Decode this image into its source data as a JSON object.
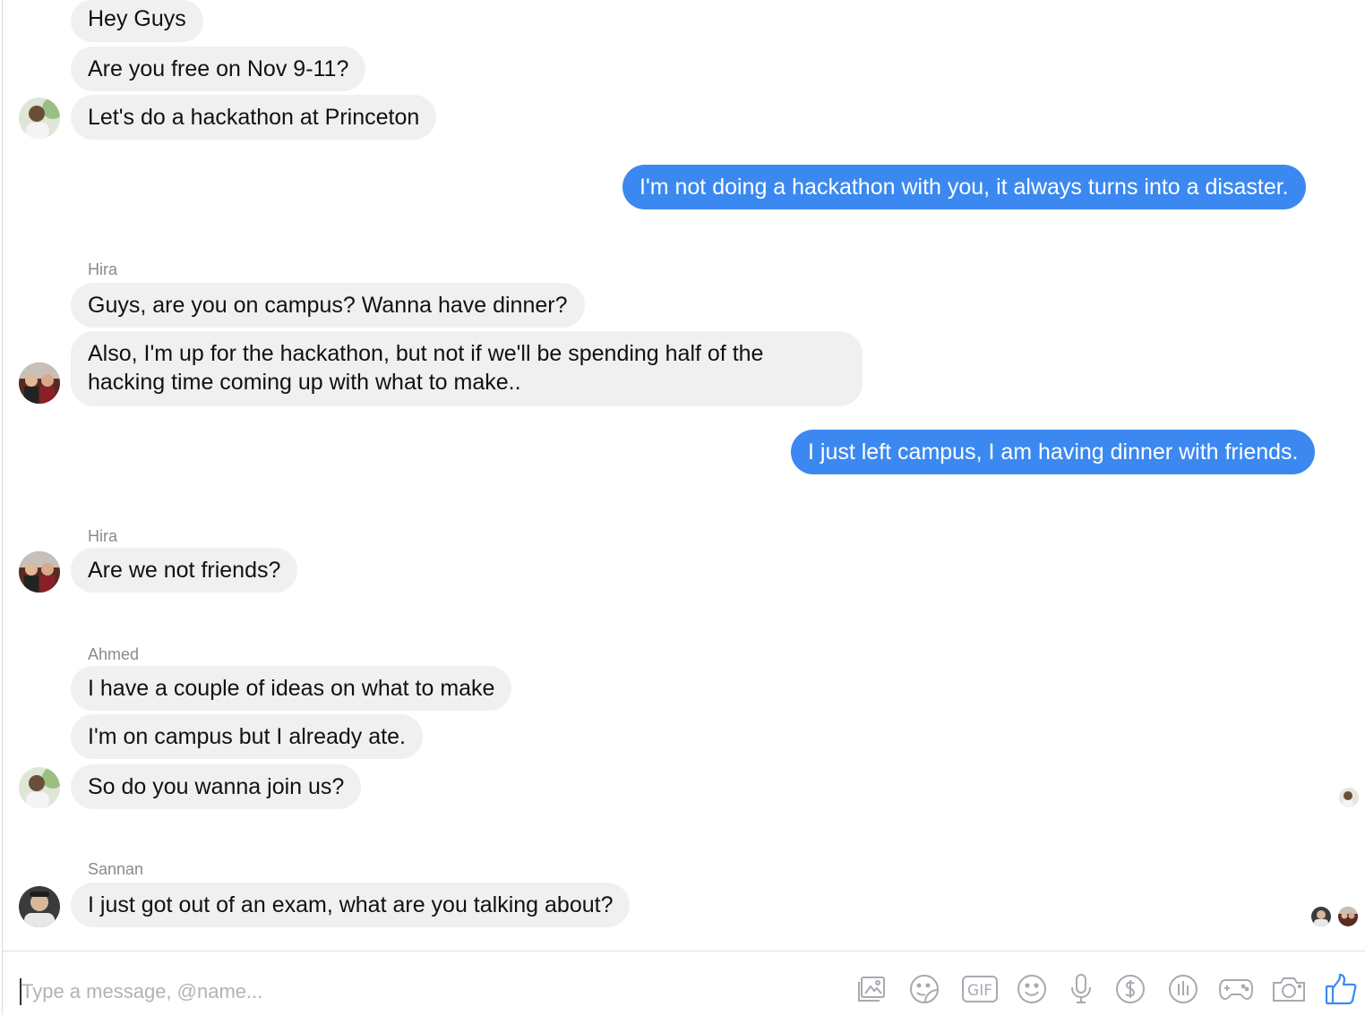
{
  "messages": [
    {
      "text": "Hey Guys"
    },
    {
      "text": "Are you free on Nov 9-11?"
    },
    {
      "text": "Let's do a hackathon at Princeton"
    },
    {
      "text": "I'm not doing a hackathon with you, it always turns into a disaster."
    },
    {
      "sender": "Hira",
      "text": "Guys, are you on campus? Wanna have dinner?"
    },
    {
      "text": "Also, I'm up for the hackathon, but not if we'll be spending half of the hacking time coming up with what to make.."
    },
    {
      "text": "I just left campus, I am having dinner with friends."
    },
    {
      "sender": "Hira",
      "text": "Are we not friends?"
    },
    {
      "sender": "Ahmed",
      "text": "I have a couple of ideas on what to make"
    },
    {
      "text": "I'm on campus but I already ate."
    },
    {
      "text": "So do you wanna join us?"
    },
    {
      "sender": "Sannan",
      "text": "I just got out of an exam, what are you talking about?"
    }
  ],
  "composer": {
    "placeholder": "Type a message, @name...",
    "tools": [
      "photo-icon",
      "sticker-icon",
      "gif-icon",
      "emoji-icon",
      "microphone-icon",
      "payment-icon",
      "poll-icon",
      "game-icon",
      "camera-icon",
      "thumbs-up-icon"
    ],
    "gif_label": "GIF"
  },
  "colors": {
    "outgoing": "#3b89f0",
    "incoming": "#f0f0f0",
    "accent": "#3b89f0"
  }
}
